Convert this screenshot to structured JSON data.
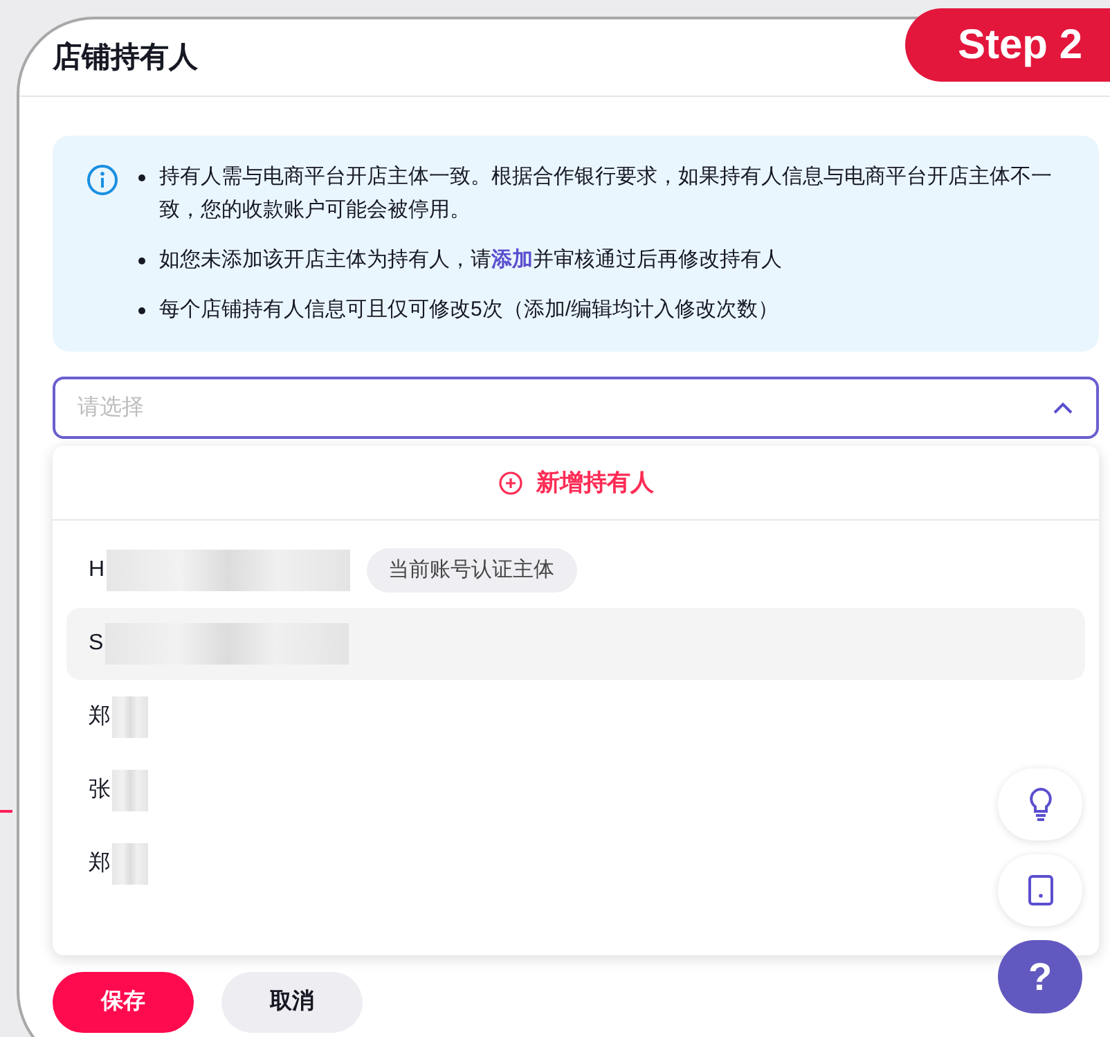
{
  "step_badge": "Step 2",
  "title": "店铺持有人",
  "notice": {
    "items": [
      {
        "text": "持有人需与电商平台开店主体一致。根据合作银行要求，如果持有人信息与电商平台开店主体不一致，您的收款账户可能会被停用。"
      },
      {
        "text": "如您未添加该开店主体为持有人，请",
        "link": "添加",
        "after": "并审核通过后再修改持有人"
      },
      {
        "text": "每个店铺持有人信息可且仅可修改5次（添加/编辑均计入修改次数）"
      }
    ]
  },
  "select": {
    "placeholder": "请选择",
    "expanded": true
  },
  "dropdown": {
    "add_label": "新增持有人",
    "options": [
      {
        "name": "H",
        "tag": "当前账号认证主体",
        "highlighted": false,
        "selected": false
      },
      {
        "name": "S",
        "highlighted": true,
        "selected": false
      },
      {
        "name": "郑",
        "highlighted": false,
        "selected": false
      },
      {
        "name": "张",
        "highlighted": false,
        "selected": false
      },
      {
        "name": "郑",
        "highlighted": false,
        "selected": false
      }
    ]
  },
  "buttons": [
    {
      "label": "保存",
      "kind": "primary"
    },
    {
      "label": "取消",
      "kind": "secondary"
    }
  ],
  "help_button": "?"
}
